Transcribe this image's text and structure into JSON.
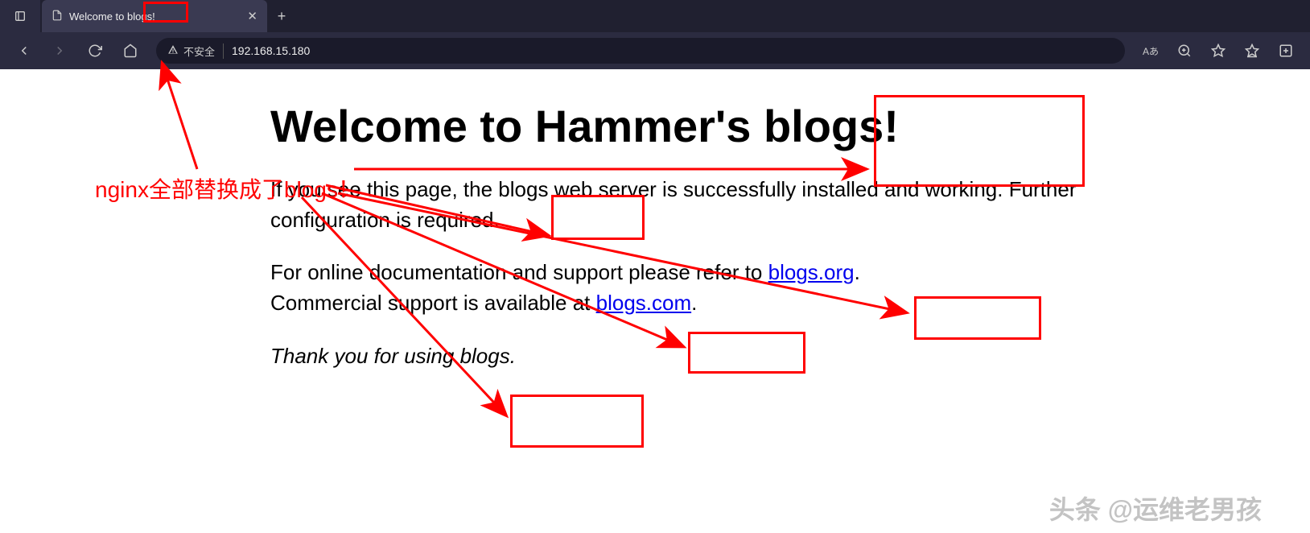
{
  "browser": {
    "tab_title": "Welcome to blogs!",
    "security_text": "不安全",
    "url": "192.168.15.180",
    "reading_mode": "Aあ"
  },
  "page": {
    "heading": "Welcome to Hammer's blogs!",
    "p1_part1": "If you see this page, the blogs web server is successfully installed and working. Further configuration is required.",
    "p2_part1": "For online documentation and support please refer to ",
    "p2_link1": "blogs.org",
    "p2_part2": ".",
    "p2_br": "Commercial support is available at ",
    "p2_link2": "blogs.com",
    "p2_part3": ".",
    "p3": "Thank you for using blogs."
  },
  "annotation": {
    "text": "nginx全部替换成了blogs！"
  },
  "watermark": "头条 @运维老男孩",
  "colors": {
    "annotation": "#ff0000",
    "link": "#0000EE",
    "chrome_bg": "#2b2b40"
  }
}
